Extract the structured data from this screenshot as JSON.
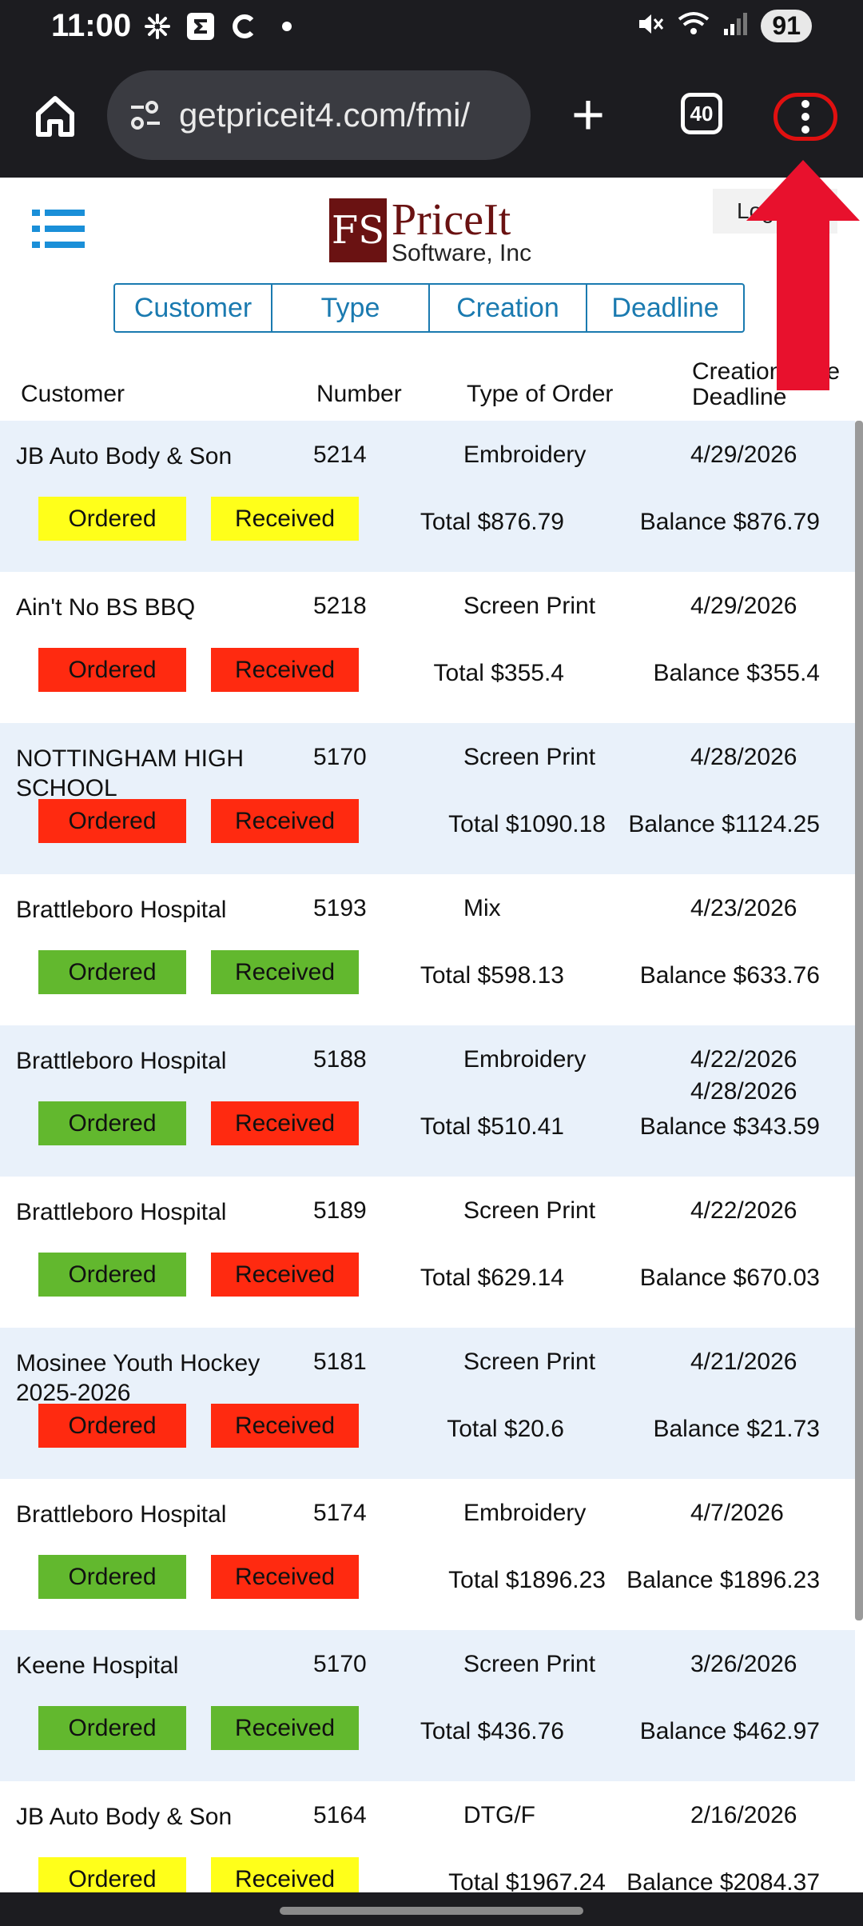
{
  "status_bar": {
    "time": "11:00",
    "battery": "91"
  },
  "browser": {
    "url": "getpriceit4.com/fmi/",
    "tab_count": "40"
  },
  "header": {
    "logo_mark": "FS",
    "logo_name": "PriceIt",
    "logo_sub": "Software, Inc",
    "logout": "Log Out"
  },
  "sort_buttons": [
    "Customer",
    "Type",
    "Creation",
    "Deadline"
  ],
  "columns": {
    "customer": "Customer",
    "number": "Number",
    "type": "Type of Order",
    "creation": "Creation Date",
    "deadline": "Deadline"
  },
  "orders": [
    {
      "customer": "JB Auto Body & Son",
      "number": "5214",
      "type": "Embroidery",
      "creation": "4/29/2026",
      "deadline": "",
      "ordered": "Ordered",
      "received": "Received",
      "ordered_color": "#ffff1a",
      "received_color": "#ffff1a",
      "total": "Total $876.79",
      "balance": "Balance $876.79"
    },
    {
      "customer": "Ain't No BS BBQ",
      "number": "5218",
      "type": "Screen Print",
      "creation": "4/29/2026",
      "deadline": "",
      "ordered": "Ordered",
      "received": "Received",
      "ordered_color": "#ff2a10",
      "received_color": "#ff2a10",
      "total": "Total $355.4",
      "balance": "Balance $355.4"
    },
    {
      "customer": "NOTTINGHAM HIGH SCHOOL",
      "number": "5170",
      "type": "Screen Print",
      "creation": "4/28/2026",
      "deadline": "",
      "ordered": "Ordered",
      "received": "Received",
      "ordered_color": "#ff2a10",
      "received_color": "#ff2a10",
      "total": "Total $1090.18",
      "balance": "Balance $1124.25"
    },
    {
      "customer": "Brattleboro Hospital",
      "number": "5193",
      "type": "Mix",
      "creation": "4/23/2026",
      "deadline": "",
      "ordered": "Ordered",
      "received": "Received",
      "ordered_color": "#62b82e",
      "received_color": "#62b82e",
      "total": "Total $598.13",
      "balance": "Balance $633.76"
    },
    {
      "customer": "Brattleboro Hospital",
      "number": "5188",
      "type": "Embroidery",
      "creation": "4/22/2026",
      "deadline": "4/28/2026",
      "ordered": "Ordered",
      "received": "Received",
      "ordered_color": "#62b82e",
      "received_color": "#ff2a10",
      "total": "Total $510.41",
      "balance": "Balance $343.59"
    },
    {
      "customer": "Brattleboro Hospital",
      "number": "5189",
      "type": "Screen Print",
      "creation": "4/22/2026",
      "deadline": "",
      "ordered": "Ordered",
      "received": "Received",
      "ordered_color": "#62b82e",
      "received_color": "#ff2a10",
      "total": "Total $629.14",
      "balance": "Balance $670.03"
    },
    {
      "customer": "Mosinee Youth Hockey 2025-2026",
      "number": "5181",
      "type": "Screen Print",
      "creation": "4/21/2026",
      "deadline": "",
      "ordered": "Ordered",
      "received": "Received",
      "ordered_color": "#ff2a10",
      "received_color": "#ff2a10",
      "total": "Total $20.6",
      "balance": "Balance $21.73"
    },
    {
      "customer": "Brattleboro Hospital",
      "number": "5174",
      "type": "Embroidery",
      "creation": "4/7/2026",
      "deadline": "",
      "ordered": "Ordered",
      "received": "Received",
      "ordered_color": "#62b82e",
      "received_color": "#ff2a10",
      "total": "Total $1896.23",
      "balance": "Balance $1896.23"
    },
    {
      "customer": "Keene Hospital",
      "number": "5170",
      "type": "Screen Print",
      "creation": "3/26/2026",
      "deadline": "",
      "ordered": "Ordered",
      "received": "Received",
      "ordered_color": "#62b82e",
      "received_color": "#62b82e",
      "total": "Total $436.76",
      "balance": "Balance $462.97"
    },
    {
      "customer": "JB Auto Body & Son",
      "number": "5164",
      "type": "DTG/F",
      "creation": "2/16/2026",
      "deadline": "",
      "ordered": "Ordered",
      "received": "Received",
      "ordered_color": "#ffff1a",
      "received_color": "#ffff1a",
      "total": "Total $1967.24",
      "balance": "Balance $2084.37"
    }
  ]
}
